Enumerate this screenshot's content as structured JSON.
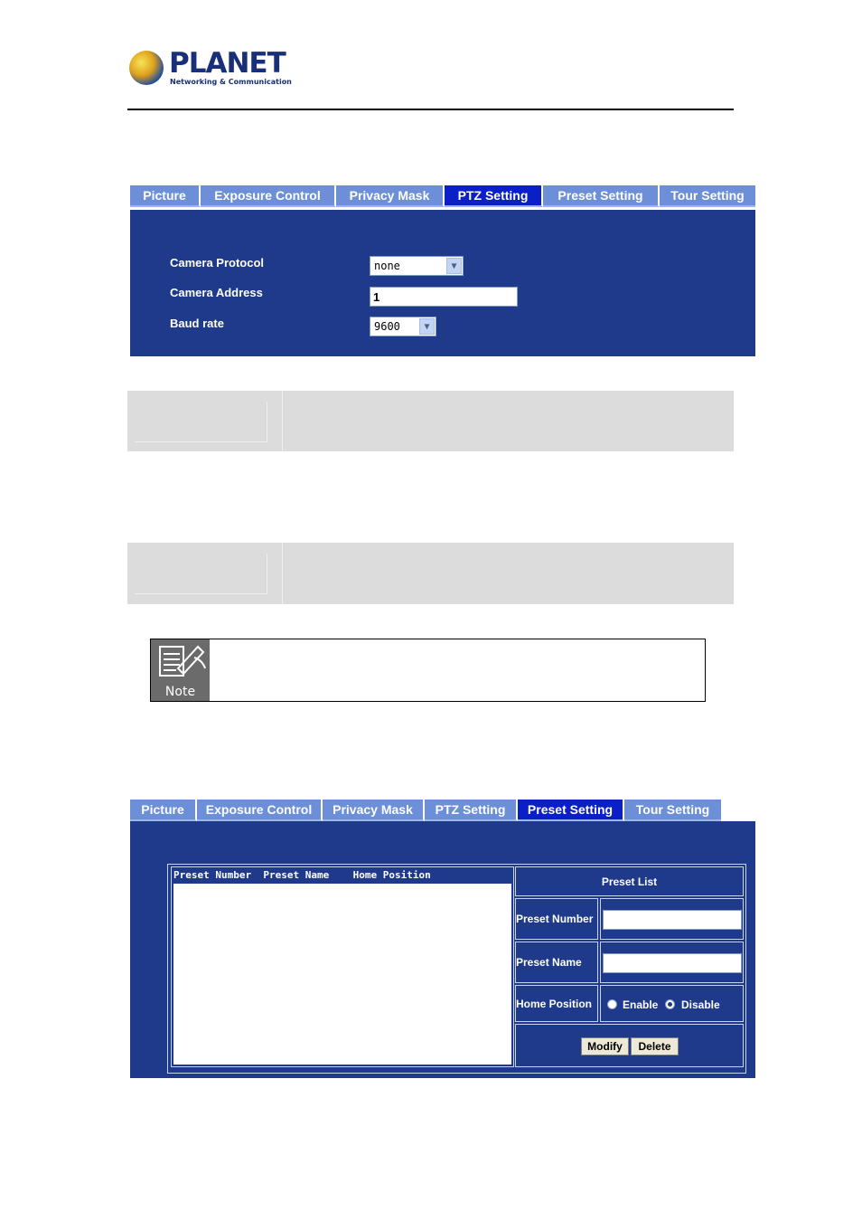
{
  "header": {
    "brand": "PLANET",
    "tagline": "Networking & Communication"
  },
  "ptz_tabs": [
    {
      "label": "Picture"
    },
    {
      "label": "Exposure Control"
    },
    {
      "label": "Privacy Mask"
    },
    {
      "label": "PTZ Setting",
      "active": true
    },
    {
      "label": "Preset Setting"
    },
    {
      "label": "Tour Setting"
    }
  ],
  "ptz_form": {
    "camera_protocol_label": "Camera Protocol",
    "camera_protocol_value": "none",
    "camera_address_label": "Camera Address",
    "camera_address_value": "1",
    "baud_rate_label": "Baud rate",
    "baud_rate_value": "9600"
  },
  "note": {
    "label": "Note"
  },
  "preset_tabs": [
    {
      "label": "Picture"
    },
    {
      "label": "Exposure Control"
    },
    {
      "label": "Privacy Mask"
    },
    {
      "label": "PTZ Setting"
    },
    {
      "label": "Preset Setting",
      "active": true
    },
    {
      "label": "Tour Setting"
    }
  ],
  "preset": {
    "list_header": "Preset Number  Preset Name    Home Position",
    "list_title": "Preset List",
    "preset_number_label": "Preset Number",
    "preset_name_label": "Preset Name",
    "home_position_label": "Home Position",
    "enable_label": "Enable",
    "disable_label": "Disable",
    "modify_label": "Modify",
    "delete_label": "Delete"
  },
  "colors": {
    "panel": "#1f3a8a",
    "tab": "#6c8fd8",
    "tab_active": "#0b1fc9"
  }
}
